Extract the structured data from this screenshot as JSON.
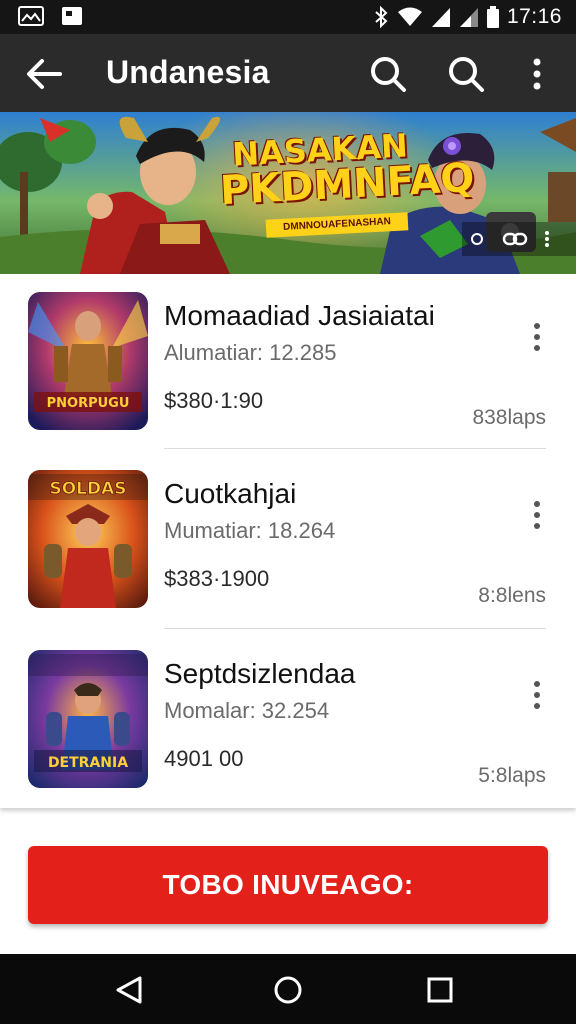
{
  "status_bar": {
    "time": "17:16",
    "icons": [
      "image-icon",
      "photo-icon",
      "bluetooth-icon",
      "wifi-icon",
      "signal-icon",
      "signal-icon",
      "battery-icon"
    ]
  },
  "app_bar": {
    "title": "Undanesia",
    "icons": [
      "back-arrow-icon",
      "search-icon",
      "search-icon",
      "more-vert-icon"
    ]
  },
  "banner": {
    "title_line1": "NASAKAN",
    "title_line2": "PKDMNFAQ",
    "tagline": "DMNNOUAFENASHAN"
  },
  "items": [
    {
      "title": "Momaadiad Jasiaiatai",
      "subtitle": "Alumatiar: 12.285",
      "price": "$380·1:90",
      "meta": "838laps",
      "thumb_label": "PNORPUGU"
    },
    {
      "title": "Cuotkahjai",
      "subtitle": "Mumatiar: 18.264",
      "price": "$383·1900",
      "meta": "8:8lens",
      "thumb_label": "SOLDAS"
    },
    {
      "title": "Septdsizlendaa",
      "subtitle": "Momalar: 32.254",
      "price": "4901 00",
      "meta": "5:8laps",
      "thumb_label": "DETRANIA"
    }
  ],
  "cta": {
    "label": "TOBO INUVEAGO:"
  },
  "colors": {
    "status_bar": "#151515",
    "app_bar": "#2b2b2b",
    "accent": "#e3211a",
    "nav_bar": "#0a0a0a"
  }
}
